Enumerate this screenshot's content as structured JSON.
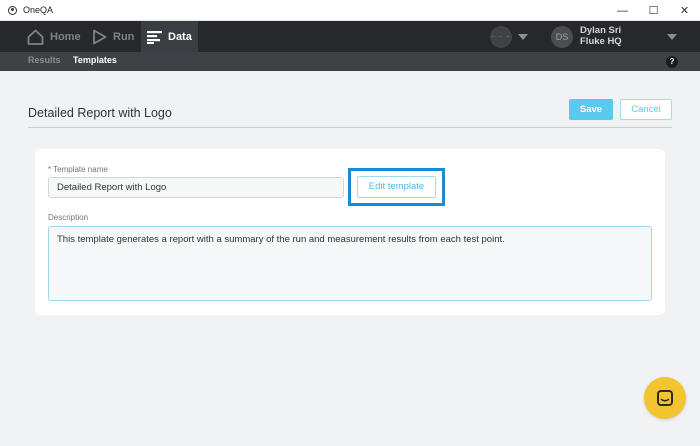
{
  "window": {
    "title": "OneQA"
  },
  "nav": {
    "home": "Home",
    "run": "Run",
    "data": "Data",
    "user_badge": "- - -",
    "avatar_initials": "DS",
    "user_name": "Dylan Sri",
    "org_name": "Fluke HQ"
  },
  "subnav": {
    "results": "Results",
    "templates": "Templates",
    "help": "?"
  },
  "page": {
    "title": "Detailed Report with Logo",
    "save_label": "Save",
    "cancel_label": "Cancel"
  },
  "form": {
    "template_name_label": "Template name",
    "template_name_value": "Detailed Report with Logo",
    "edit_template_label": "Edit template",
    "description_label": "Description",
    "description_value": "This template generates a report with a summary of the run and measurement results from each test point."
  },
  "colors": {
    "accent": "#5bc8ef",
    "highlight": "#1d8bd1",
    "nav_bg": "#26282b",
    "chat": "#f2c530"
  },
  "icons": [
    "home-icon",
    "run-icon",
    "data-icon",
    "chevron-down-icon",
    "help-icon",
    "chat-icon"
  ]
}
